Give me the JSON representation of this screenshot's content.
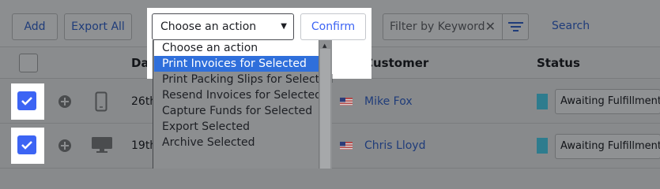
{
  "toolbar": {
    "add_label": "Add",
    "export_all_label": "Export All",
    "filter_placeholder": "Filter by Keyword",
    "search_label": "Search"
  },
  "bulk_action": {
    "selected_value": "Choose an action",
    "confirm_label": "Confirm",
    "options": [
      "Choose an action",
      "Print Invoices for Selected",
      "Print Packing Slips for Selected",
      "Resend Invoices for Selected",
      "Capture Funds for Selected",
      "Export Selected",
      "Archive Selected"
    ],
    "highlighted_option": "Print Invoices for Selected"
  },
  "table": {
    "columns": {
      "date": "Date",
      "customer": "Customer",
      "status": "Status"
    },
    "rows": [
      {
        "date": "26th",
        "customer": "Mike Fox",
        "status": "Awaiting Fulfillment",
        "device": "mobile-icon",
        "checked": true
      },
      {
        "date": "19th",
        "customer": "Chris Lloyd",
        "status": "Awaiting Fulfillment",
        "device": "desktop-icon",
        "checked": true
      }
    ]
  },
  "colors": {
    "accent": "#3c64f4",
    "selected_option": "#2f6fdb",
    "status_swatch": "#2e7c8e"
  }
}
